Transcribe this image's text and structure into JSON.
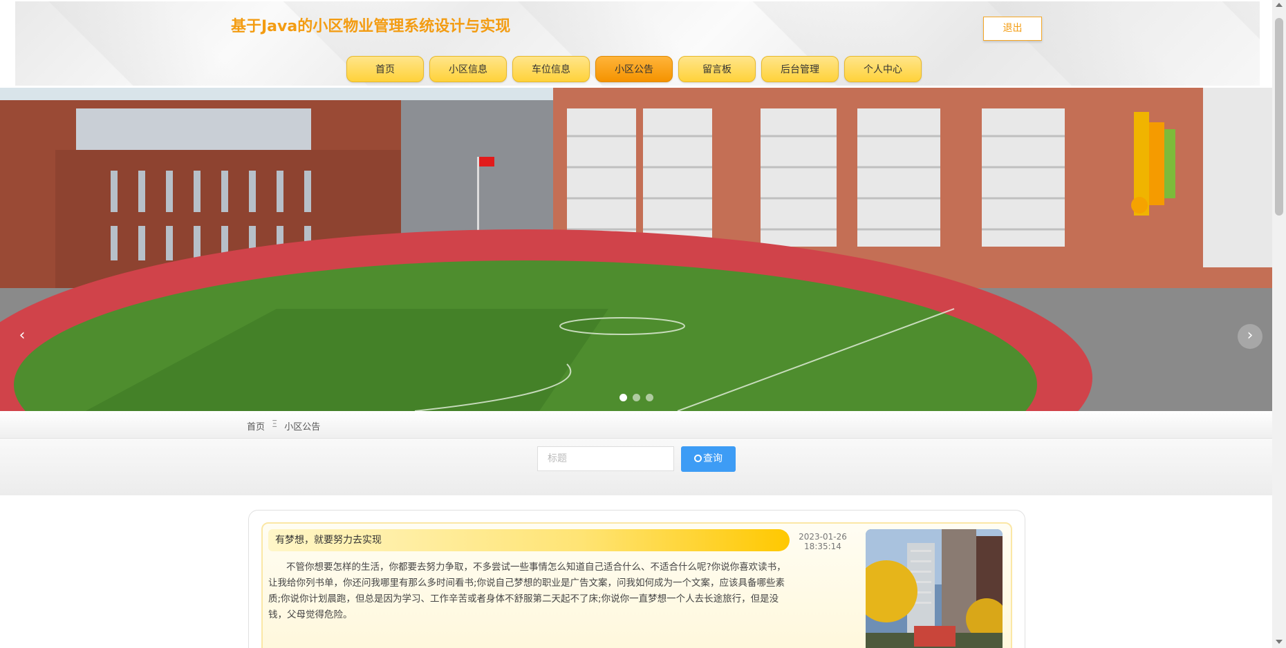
{
  "header": {
    "title": "基于Java的小区物业管理系统设计与实现",
    "logout_label": "退出"
  },
  "nav": {
    "items": [
      {
        "label": "首页"
      },
      {
        "label": "小区信息"
      },
      {
        "label": "车位信息"
      },
      {
        "label": "小区公告"
      },
      {
        "label": "留言板"
      },
      {
        "label": "后台管理"
      },
      {
        "label": "个人中心"
      }
    ],
    "active": "小区公告"
  },
  "carousel": {
    "prev_icon": "‹",
    "next_icon": "›",
    "slide_count": 3,
    "active_index": 0
  },
  "breadcrumb": {
    "home": "首页",
    "separator": "Ξ",
    "current": "小区公告"
  },
  "search": {
    "placeholder": "标题",
    "value": "",
    "button_label": "查询"
  },
  "notices": [
    {
      "title": "有梦想，就要努力去实现",
      "date": "2023-01-26",
      "time": "18:35:14",
      "body": "不管你想要怎样的生活，你都要去努力争取，不多尝试一些事情怎么知道自己适合什么、不适合什么呢?你说你喜欢读书，让我给你列书单，你还问我哪里有那么多时间看书;你说自己梦想的职业是广告文案，问我如何成为一个文案，应该具备哪些素质;你说你计划晨跑，但总是因为学习、工作辛苦或者身体不舒服第二天起不了床;你说你一直梦想一个人去长途旅行，但是没钱，父母觉得危险。"
    }
  ],
  "colors": {
    "accent": "#f39c12",
    "nav_active": "#f59300",
    "nav_default": "#ffd23a",
    "search_button": "#3d9cf5"
  }
}
